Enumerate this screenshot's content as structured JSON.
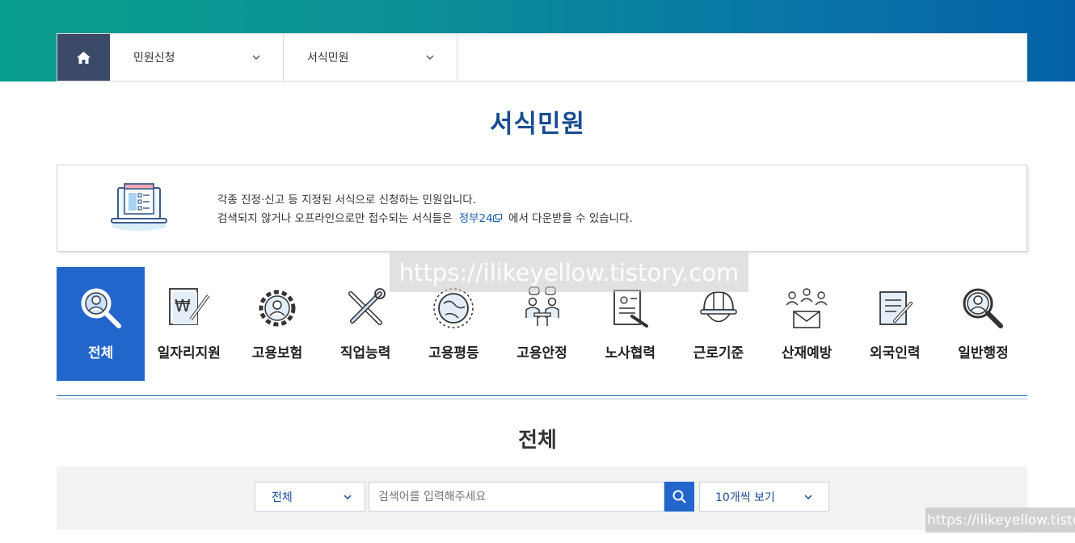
{
  "nav": {
    "menu1": "민원신청",
    "menu2": "서식민원"
  },
  "page_title": "서식민원",
  "info": {
    "line1": "각종 진정·신고 등 지정된 서식으로 신청하는 민원입니다.",
    "line2_before": "검색되지 않거나 오프라인으로만 접수되는 서식들은",
    "link": "정부24",
    "line2_after": "에서 다운받을 수 있습니다."
  },
  "categories": [
    {
      "label": "전체",
      "icon": "person-search-icon",
      "active": true
    },
    {
      "label": "일자리지원",
      "icon": "won-document-icon",
      "active": false
    },
    {
      "label": "고용보험",
      "icon": "gear-person-icon",
      "active": false
    },
    {
      "label": "직업능력",
      "icon": "tools-icon",
      "active": false
    },
    {
      "label": "고용평등",
      "icon": "globe-cycle-icon",
      "active": false
    },
    {
      "label": "고용안정",
      "icon": "meeting-icon",
      "active": false
    },
    {
      "label": "노사협력",
      "icon": "contract-icon",
      "active": false
    },
    {
      "label": "근로기준",
      "icon": "helmet-icon",
      "active": false
    },
    {
      "label": "산재예방",
      "icon": "people-mail-icon",
      "active": false
    },
    {
      "label": "외국인력",
      "icon": "form-pen-icon",
      "active": false
    },
    {
      "label": "일반행정",
      "icon": "person-search-icon",
      "active": false
    }
  ],
  "section_title": "전체",
  "search": {
    "category_value": "전체",
    "placeholder": "검색어를 입력해주세요",
    "count_value": "10개씩 보기"
  },
  "watermark": "https://ilikeyellow.tistory.com",
  "colors": {
    "primary": "#2266cc",
    "title": "#1a4d8f",
    "home": "#3b4a68"
  }
}
